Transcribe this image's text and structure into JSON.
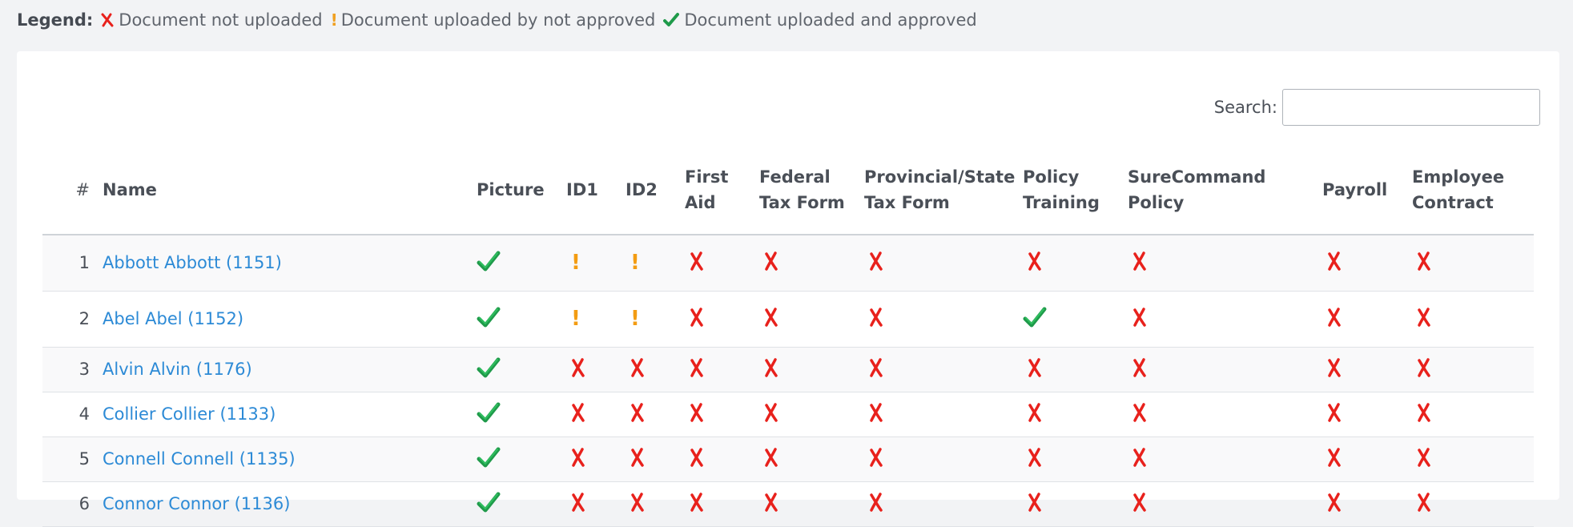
{
  "legend": {
    "label": "Legend:",
    "not_uploaded": "Document not uploaded",
    "uploaded_not_approved": "Document uploaded by not approved",
    "approved": "Document uploaded and approved"
  },
  "search": {
    "label": "Search:",
    "value": "",
    "placeholder": ""
  },
  "table": {
    "columns": [
      {
        "key": "num",
        "label": "#"
      },
      {
        "key": "name",
        "label": "Name"
      },
      {
        "key": "picture",
        "label": "Picture"
      },
      {
        "key": "id1",
        "label": "ID1"
      },
      {
        "key": "id2",
        "label": "ID2"
      },
      {
        "key": "first_aid",
        "label": "First Aid"
      },
      {
        "key": "federal_tax",
        "label": "Federal Tax Form"
      },
      {
        "key": "provincial_tax",
        "label": "Provincial/State Tax Form"
      },
      {
        "key": "policy_training",
        "label": "Policy Training"
      },
      {
        "key": "surecommand_policy",
        "label": "SureCommand Policy"
      },
      {
        "key": "payroll",
        "label": "Payroll"
      },
      {
        "key": "employee_contract",
        "label": "Employee Contract"
      }
    ],
    "rows": [
      {
        "num": "1",
        "name": "Abbott Abbott (1151)",
        "status": [
          "approved",
          "pending",
          "pending",
          "missing",
          "missing",
          "missing",
          "missing",
          "missing",
          "missing",
          "missing"
        ]
      },
      {
        "num": "2",
        "name": "Abel Abel (1152)",
        "status": [
          "approved",
          "pending",
          "pending",
          "missing",
          "missing",
          "missing",
          "approved",
          "missing",
          "missing",
          "missing"
        ]
      },
      {
        "num": "3",
        "name": "Alvin Alvin (1176)",
        "status": [
          "approved",
          "missing",
          "missing",
          "missing",
          "missing",
          "missing",
          "missing",
          "missing",
          "missing",
          "missing"
        ]
      },
      {
        "num": "4",
        "name": "Collier Collier (1133)",
        "status": [
          "approved",
          "missing",
          "missing",
          "missing",
          "missing",
          "missing",
          "missing",
          "missing",
          "missing",
          "missing"
        ]
      },
      {
        "num": "5",
        "name": "Connell Connell (1135)",
        "status": [
          "approved",
          "missing",
          "missing",
          "missing",
          "missing",
          "missing",
          "missing",
          "missing",
          "missing",
          "missing"
        ]
      },
      {
        "num": "6",
        "name": "Connor Connor (1136)",
        "status": [
          "approved",
          "missing",
          "missing",
          "missing",
          "missing",
          "missing",
          "missing",
          "missing",
          "missing",
          "missing"
        ]
      }
    ]
  },
  "icons": {
    "missing": {
      "name": "red-x-icon",
      "color": "#e8211c"
    },
    "pending": {
      "name": "exclamation-icon",
      "color": "#f39c12"
    },
    "approved": {
      "name": "green-check-icon",
      "color": "#1f9a4a"
    }
  }
}
